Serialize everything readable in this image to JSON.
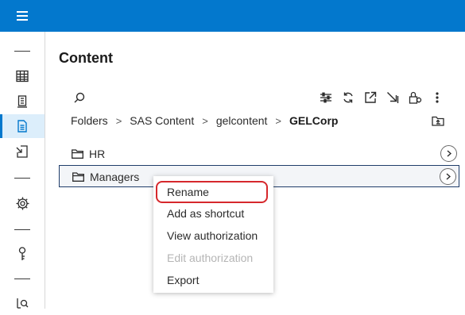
{
  "topbar": {
    "menu_icon": "hamburger-menu-icon",
    "accent": "#0378cd"
  },
  "siderail": {
    "items": [
      {
        "icon": "table-icon"
      },
      {
        "icon": "report-icon"
      },
      {
        "icon": "content-document-icon",
        "active": true
      },
      {
        "icon": "import-icon"
      },
      {
        "icon": "gear-icon"
      },
      {
        "icon": "key-icon"
      },
      {
        "icon": "search-log-icon"
      }
    ]
  },
  "main": {
    "title": "Content",
    "toolbar": [
      "search-icon",
      "sort-filter-icon",
      "refresh-icon",
      "open-external-icon",
      "move-in-icon",
      "permissions-lock-icon",
      "more-options-icon"
    ],
    "breadcrumb": [
      "Folders",
      "SAS Content",
      "gelcontent",
      "GELCorp"
    ],
    "breadcrumb_separator": ">",
    "folders": [
      {
        "name": "HR",
        "selected": false
      },
      {
        "name": "Managers",
        "selected": true
      }
    ]
  },
  "context_menu": {
    "items": [
      {
        "label": "Rename",
        "disabled": false,
        "highlighted": true
      },
      {
        "label": "Add as shortcut",
        "disabled": false
      },
      {
        "label": "View authorization",
        "disabled": false
      },
      {
        "label": "Edit authorization",
        "disabled": true
      },
      {
        "label": "Export",
        "disabled": false
      }
    ]
  }
}
